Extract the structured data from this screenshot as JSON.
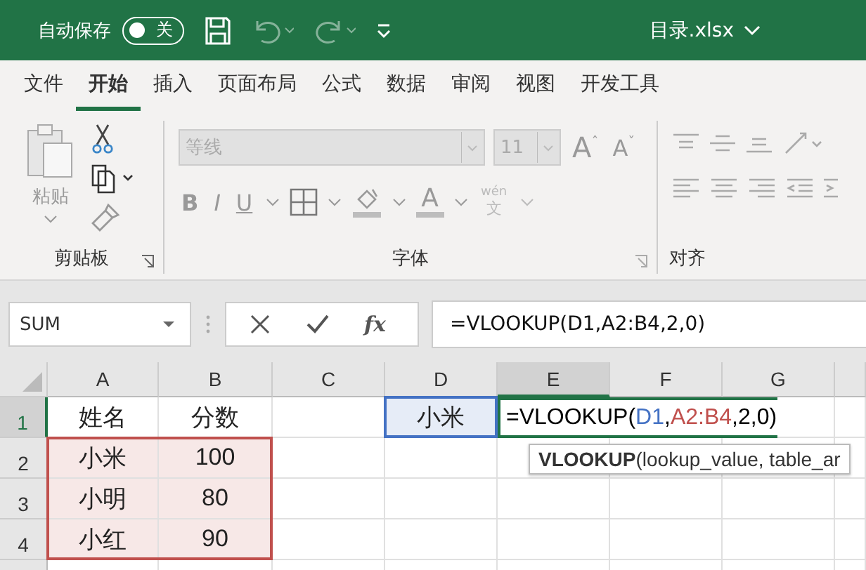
{
  "title_bar": {
    "autosave_label": "自动保存",
    "autosave": {
      "on": false,
      "label": "关"
    },
    "undo_disabled": true,
    "redo_disabled": true,
    "filename": "目录.xlsx"
  },
  "tabs": [
    {
      "label": "文件",
      "selected": false
    },
    {
      "label": "开始",
      "selected": true
    },
    {
      "label": "插入",
      "selected": false
    },
    {
      "label": "页面布局",
      "selected": false
    },
    {
      "label": "公式",
      "selected": false
    },
    {
      "label": "数据",
      "selected": false
    },
    {
      "label": "审阅",
      "selected": false
    },
    {
      "label": "视图",
      "selected": false
    },
    {
      "label": "开发工具",
      "selected": false
    }
  ],
  "ribbon": {
    "paste_label": "粘贴",
    "clipboard_label": "剪贴板",
    "font_name": "等线",
    "font_size": "11",
    "grow": "A",
    "grow_mark": "ˆ",
    "shrink": "A",
    "shrink_mark": "ˇ",
    "bold": "B",
    "italic": "I",
    "underline": "U",
    "font_color": "A",
    "phonetic_top": "wén",
    "phonetic_bottom": "文",
    "font_label": "字体",
    "align_label": "对齐"
  },
  "formula_bar": {
    "name_box": "SUM",
    "fx": "fx",
    "formula": "=VLOOKUP(D1,A2:B4,2,0)"
  },
  "columns": [
    {
      "label": "A",
      "selected": false
    },
    {
      "label": "B",
      "selected": false
    },
    {
      "label": "C",
      "selected": false
    },
    {
      "label": "D",
      "selected": false
    },
    {
      "label": "E",
      "selected": true
    },
    {
      "label": "F",
      "selected": false
    },
    {
      "label": "G",
      "selected": false
    }
  ],
  "rows": [
    {
      "label": "1",
      "selected": true,
      "cells": [
        {
          "text": "姓名"
        },
        {
          "text": "分数"
        },
        {},
        {
          "text": "小米",
          "color": "#4472c4"
        }
      ]
    },
    {
      "label": "2",
      "selected": false,
      "cells": [
        {
          "text": "小米",
          "color": "#c0504d"
        },
        {
          "text": "100",
          "color": "#c0504d"
        }
      ]
    },
    {
      "label": "3",
      "selected": false,
      "cells": [
        {
          "text": "小明",
          "color": "#c0504d"
        },
        {
          "text": "80",
          "color": "#c0504d"
        }
      ]
    },
    {
      "label": "4",
      "selected": false,
      "cells": [
        {
          "text": "小红",
          "color": "#c0504d"
        },
        {
          "text": "90",
          "color": "#c0504d"
        }
      ]
    }
  ],
  "editing_cell": {
    "segments": [
      {
        "text": "=VLOOKUP(",
        "color": "#000000"
      },
      {
        "text": "D1",
        "color": "#4472c4"
      },
      {
        "text": ",",
        "color": "#000000"
      },
      {
        "text": "A2:B4",
        "color": "#c0504d"
      },
      {
        "text": ",2,0)",
        "color": "#000000"
      }
    ],
    "tooltip": "**VLOOKUP**(lookup_value, table_ar"
  }
}
